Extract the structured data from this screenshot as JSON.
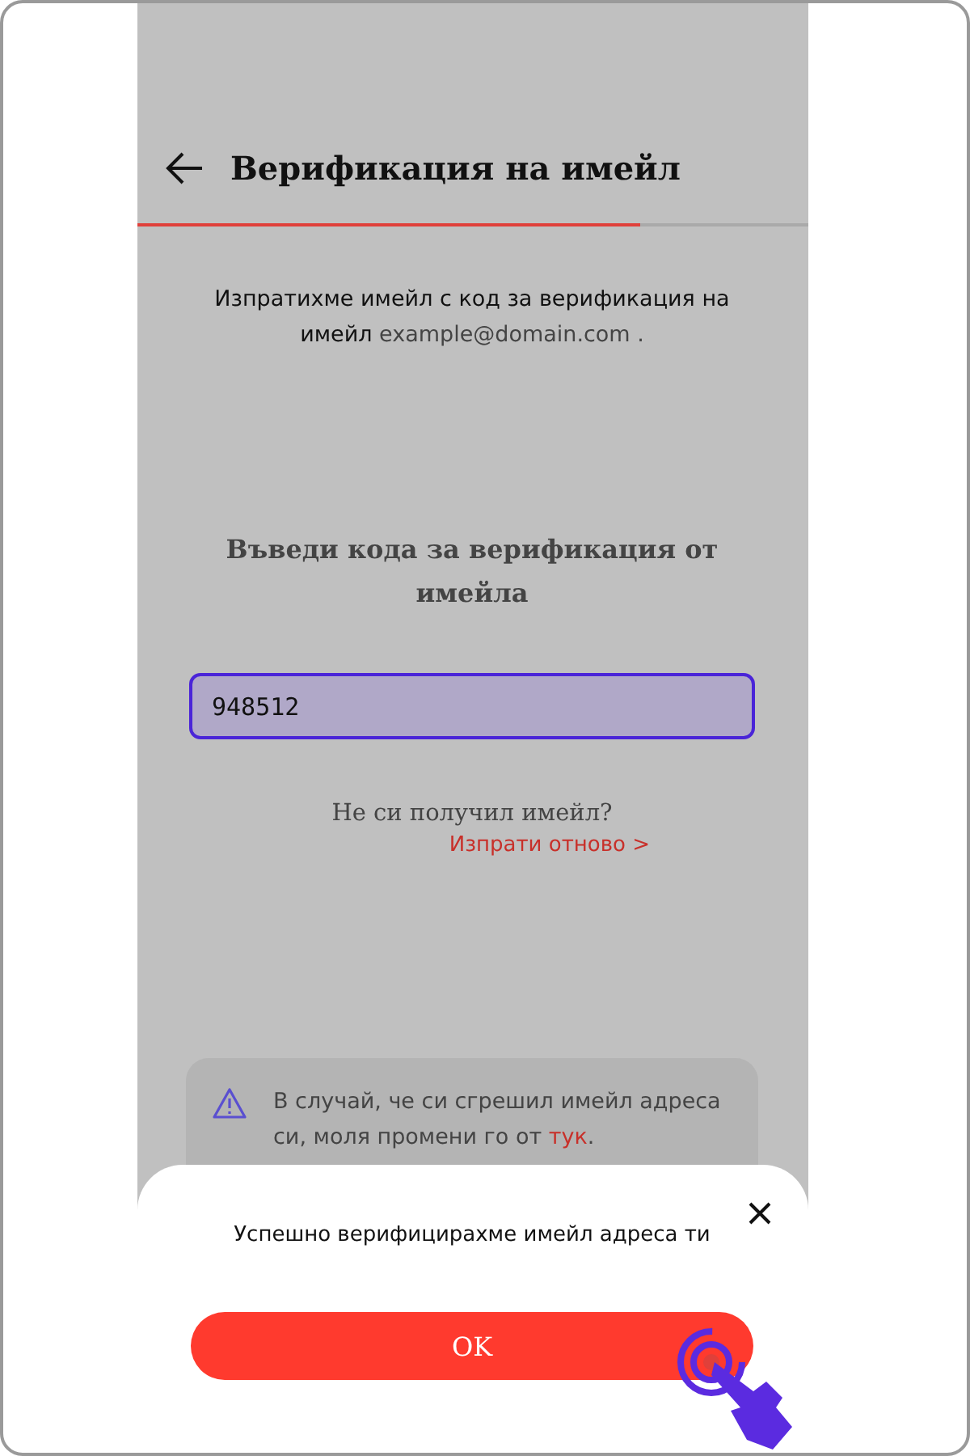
{
  "header": {
    "title": "Верификация на имейл"
  },
  "progress": {
    "level": 0.75
  },
  "intro": {
    "text": "Изпратихме имейл с код за верификация на имейл",
    "email": "example@domain.com ."
  },
  "code_prompt": "Въведи кода за верификация от имейла",
  "code_field": {
    "value": "948512",
    "focused": true
  },
  "resend": {
    "question": "Не си получил имейл?",
    "link": "Изпрати отново >"
  },
  "notice": {
    "text_before": "В случай, че си сгрешил имейл адреса си, моля промени го от ",
    "link": "тук",
    "text_after": "."
  },
  "dialog": {
    "message": "Успешно верифицирахме имейл адреса ти",
    "button": "OK"
  }
}
